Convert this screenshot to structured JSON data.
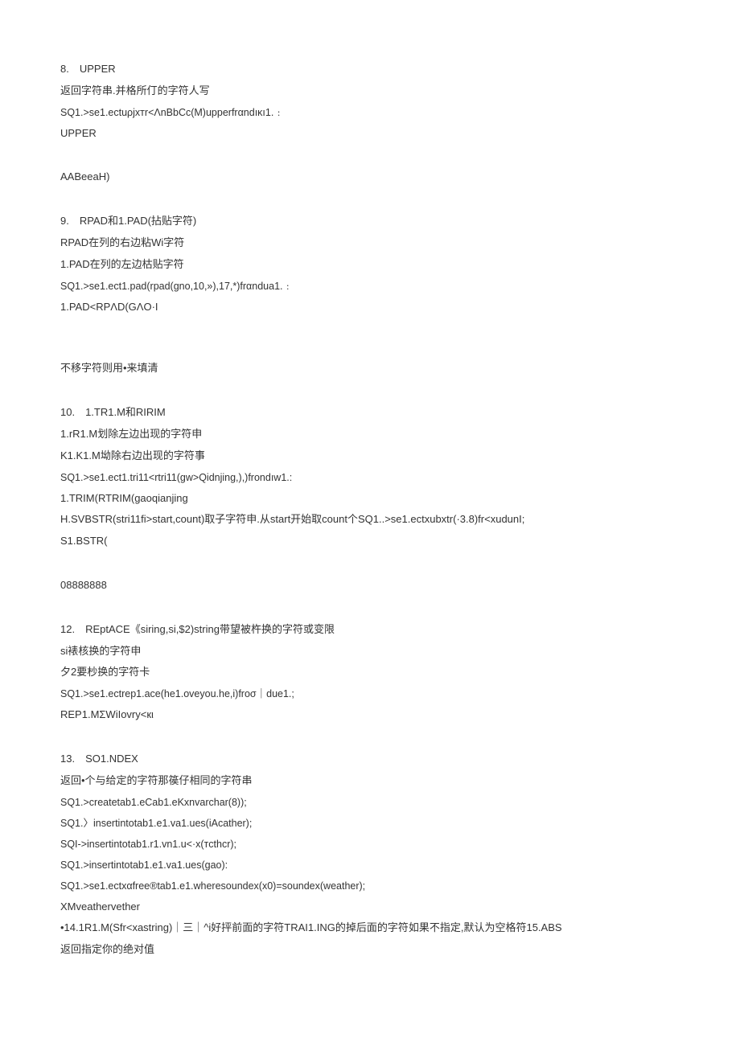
{
  "lines": [
    {
      "t": "8.　UPPER",
      "cls": "line"
    },
    {
      "t": "返回字符串.并格所仃的字符人写",
      "cls": "line"
    },
    {
      "t": "SQ1.>se1.ectuρjxтr<ΛnBbCc(M)upperfrαndıκı1.﹕",
      "cls": "line sql"
    },
    {
      "t": "UPPER",
      "cls": "line"
    },
    {
      "t": "",
      "cls": "gap"
    },
    {
      "t": "AABeeaH)",
      "cls": "line"
    },
    {
      "t": "",
      "cls": "gap"
    },
    {
      "t": "9.　RPAD和1.PAD(拈贴字符)",
      "cls": "line"
    },
    {
      "t": "RPAD在列的右边粘Wi字符",
      "cls": "line"
    },
    {
      "t": "1.PAD在列的左边枯贴字符",
      "cls": "line"
    },
    {
      "t": "SQ1.>se1.ect1.pad(rpad(gno,10,»),17,*)frαndua1.﹕",
      "cls": "line sql"
    },
    {
      "t": "1.PAD<RPΛD(GΛO·I",
      "cls": "line"
    },
    {
      "t": "",
      "cls": "gap"
    },
    {
      "t": "",
      "cls": "gap"
    },
    {
      "t": "不移字符则用•来填清",
      "cls": "line"
    },
    {
      "t": "",
      "cls": "gap"
    },
    {
      "t": "10.　1.TR1.M和RIRIM",
      "cls": "line"
    },
    {
      "t": "1.rR1.M划除左边出现的字符申",
      "cls": "line"
    },
    {
      "t": "K1.K1.M坳除右边出现的字符事",
      "cls": "line"
    },
    {
      "t": "SQ1.>se1.ect1.tri11<rtri11(gw>Qidnjing,),)frondıw1.:",
      "cls": "line sql"
    },
    {
      "t": "1.TRIM(RTRIM(gaoqianjing",
      "cls": "line"
    },
    {
      "t": "H.SVBSTR(stri11fi>start,count)取子字符申.从start开始取count个SQ1..>se1.ectxubxtr(·3.8)fr<xudunI;",
      "cls": "line"
    },
    {
      "t": "S1.BSTR(",
      "cls": "line"
    },
    {
      "t": "",
      "cls": "gap"
    },
    {
      "t": "08888888",
      "cls": "line"
    },
    {
      "t": "",
      "cls": "gap"
    },
    {
      "t": "12.　REptACE《siring,si,$2)string带望被杵换的字符或变限",
      "cls": "line"
    },
    {
      "t": "si裱核换的字符申",
      "cls": "line"
    },
    {
      "t": "夕2要杪换的字符卡",
      "cls": "line"
    },
    {
      "t": "SQ1.>se1.ectrep1.ace(he1.oveyou.he,i)froσ｜due1.;",
      "cls": "line sql"
    },
    {
      "t": "REP1.MΣWiIovry<кι",
      "cls": "line"
    },
    {
      "t": "",
      "cls": "gap"
    },
    {
      "t": "13.　SO1.NDEX",
      "cls": "line"
    },
    {
      "t": "返回•个与给定的字符那篌仔相同的字符串",
      "cls": "line"
    },
    {
      "t": "SQ1.>createtab1.eCab1.eKxnvarchar(8));",
      "cls": "line sql"
    },
    {
      "t": "SQ1.〉insertintotab1.e1.va1.ues(iAcather);",
      "cls": "line sql"
    },
    {
      "t": "SQI->insertintotab1.r1.vn1.u<·x(тcthcr);",
      "cls": "line sql"
    },
    {
      "t": "SQ1.>insertintotab1.e1.va1.ues(gao):",
      "cls": "line sql"
    },
    {
      "t": "SQ1.>se1.ectxαfree®tab1.e1.wheresoundex(x0)=soundex(weather);",
      "cls": "line sql"
    },
    {
      "t": "XMveathervether",
      "cls": "line"
    },
    {
      "t": "•14.1R1.M(Sfr<xastring)｜三｜^i好抨前面的字符TRAI1.ING的掉后面的字符如果不指定,默认为空格符15.ABS",
      "cls": "line"
    },
    {
      "t": "返回指定你的绝对值",
      "cls": "line"
    }
  ]
}
